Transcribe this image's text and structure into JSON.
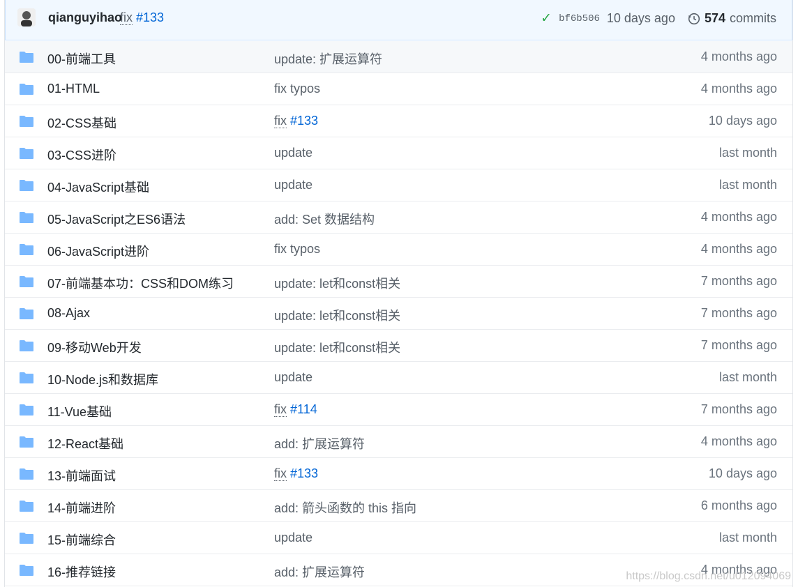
{
  "header": {
    "author": "qianguyihao",
    "message_plain": "fix",
    "message_issue": "#133",
    "sha": "bf6b506",
    "time": "10 days ago",
    "commits_count": "574",
    "commits_label": "commits",
    "icons": {
      "status": "check-icon",
      "history": "history-icon"
    },
    "colors": {
      "check": "#28a745",
      "link": "#0366d6",
      "folder": "#79b8ff"
    }
  },
  "rows": [
    {
      "name": "00-前端工具",
      "plain": "update: 扩展运算符",
      "issue": "",
      "age": "4 months ago"
    },
    {
      "name": "01-HTML",
      "plain": "fix typos",
      "issue": "",
      "age": "4 months ago"
    },
    {
      "name": "02-CSS基础",
      "plain": "fix",
      "issue": "#133",
      "age": "10 days ago"
    },
    {
      "name": "03-CSS进阶",
      "plain": "update",
      "issue": "",
      "age": "last month"
    },
    {
      "name": "04-JavaScript基础",
      "plain": "update",
      "issue": "",
      "age": "last month"
    },
    {
      "name": "05-JavaScript之ES6语法",
      "plain": "add: Set 数据结构",
      "issue": "",
      "age": "4 months ago"
    },
    {
      "name": "06-JavaScript进阶",
      "plain": "fix typos",
      "issue": "",
      "age": "4 months ago"
    },
    {
      "name": "07-前端基本功：CSS和DOM练习",
      "plain": "update: let和const相关",
      "issue": "",
      "age": "7 months ago"
    },
    {
      "name": "08-Ajax",
      "plain": "update: let和const相关",
      "issue": "",
      "age": "7 months ago"
    },
    {
      "name": "09-移动Web开发",
      "plain": "update: let和const相关",
      "issue": "",
      "age": "7 months ago"
    },
    {
      "name": "10-Node.js和数据库",
      "plain": "update",
      "issue": "",
      "age": "last month"
    },
    {
      "name": "11-Vue基础",
      "plain": "fix",
      "issue": "#114",
      "age": "7 months ago"
    },
    {
      "name": "12-React基础",
      "plain": "add: 扩展运算符",
      "issue": "",
      "age": "4 months ago"
    },
    {
      "name": "13-前端面试",
      "plain": "fix",
      "issue": "#133",
      "age": "10 days ago"
    },
    {
      "name": "14-前端进阶",
      "plain": "add: 箭头函数的 this 指向",
      "issue": "",
      "age": "6 months ago"
    },
    {
      "name": "15-前端综合",
      "plain": "update",
      "issue": "",
      "age": "last month"
    },
    {
      "name": "16-推荐链接",
      "plain": "add: 扩展运算符",
      "issue": "",
      "age": "4 months ago"
    }
  ],
  "watermark": "https://blog.csdn.net/u012094069"
}
